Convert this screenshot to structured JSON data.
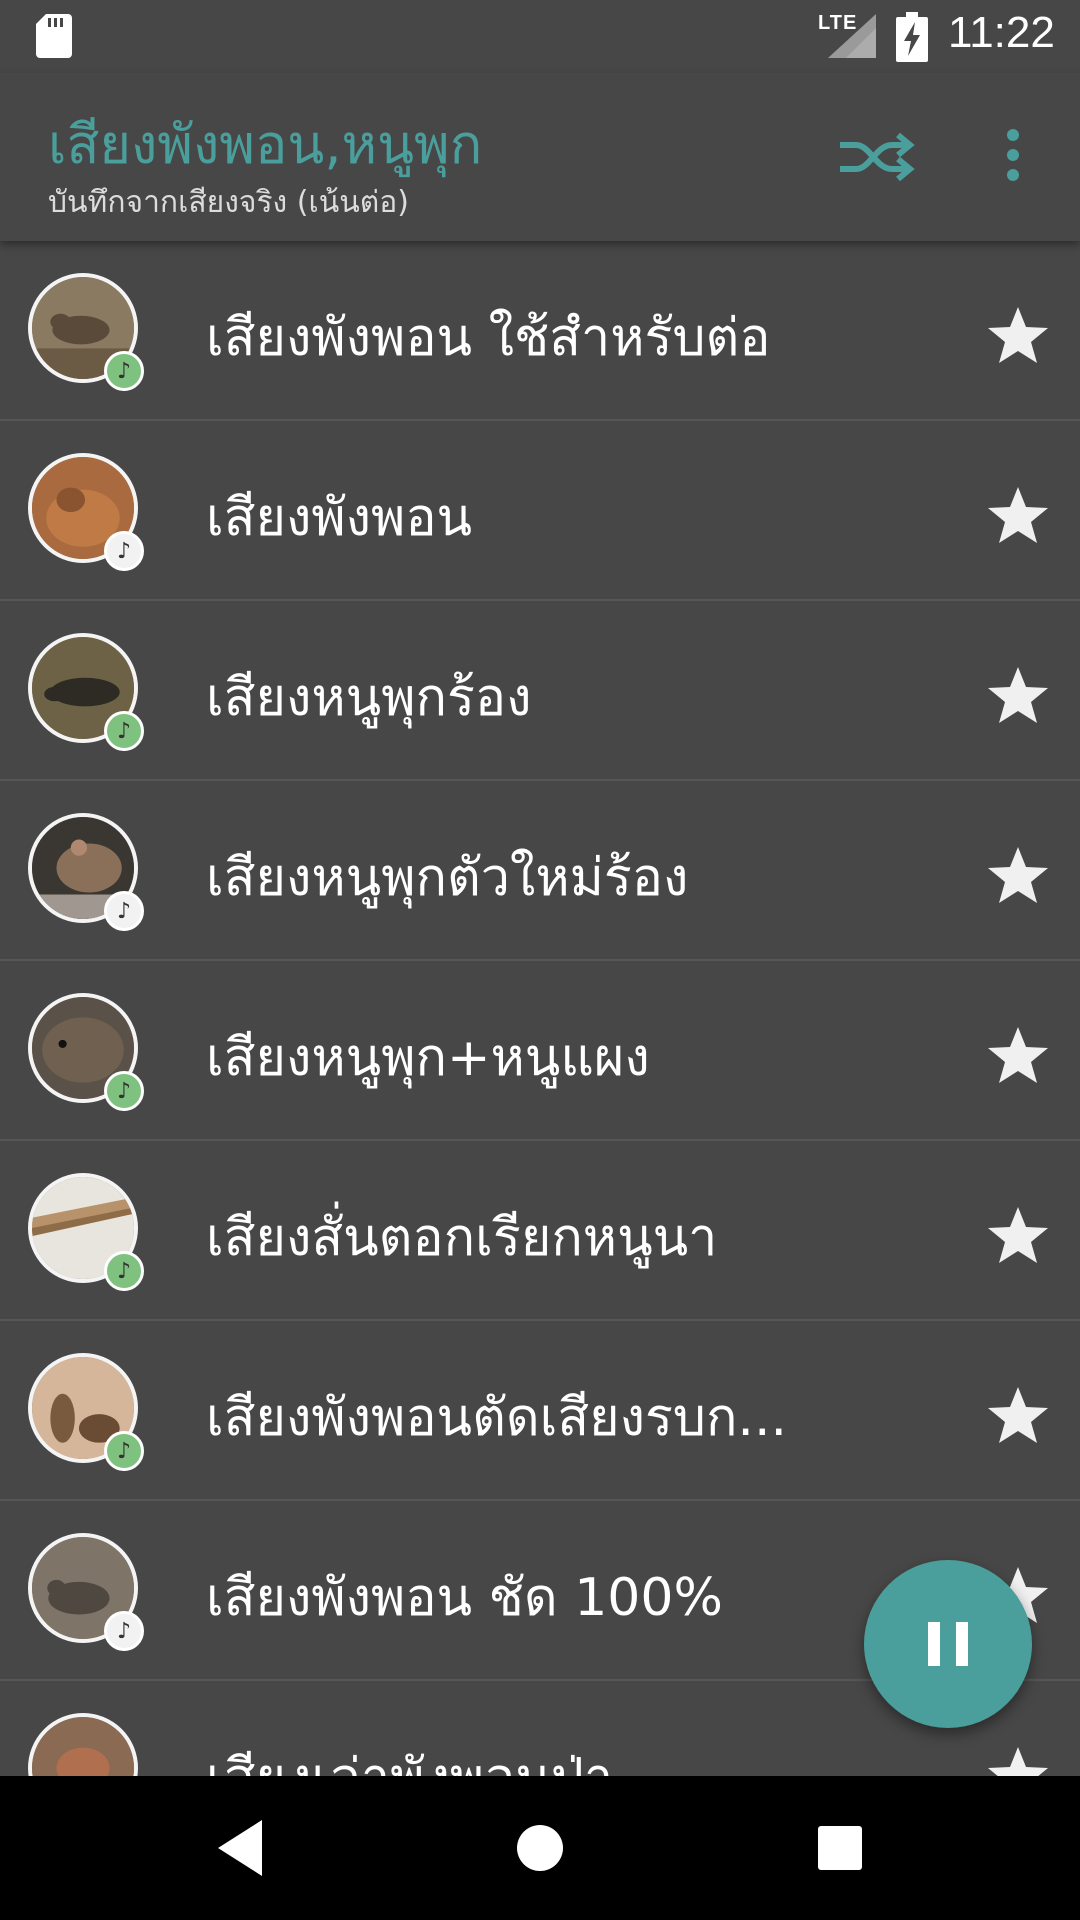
{
  "status_bar": {
    "time": "11:22",
    "network": "LTE",
    "icons": [
      "sd-card-icon",
      "signal-icon",
      "battery-charging-icon"
    ]
  },
  "app_bar": {
    "title": "เสียงพังพอน,หนูพุก",
    "subtitle": "บันทึกจากเสียงจริง (เน้นต่อ)",
    "actions": [
      "shuffle-icon",
      "more-vert-icon"
    ]
  },
  "list": {
    "items": [
      {
        "title": "เสียงพังพอน ใช้สำหรับต่อ",
        "badge": "green",
        "image": "mongoose"
      },
      {
        "title": "เสียงพังพอน",
        "badge": "white",
        "image": "mongoose-orange"
      },
      {
        "title": "เสียงหนูพุกร้อง",
        "badge": "green",
        "image": "rat-dark"
      },
      {
        "title": "เสียงหนูพุกตัวใหม่ร้อง",
        "badge": "white",
        "image": "rat-brown"
      },
      {
        "title": "เสียงหนูพุก+หนูแผง",
        "badge": "green",
        "image": "rat-grey"
      },
      {
        "title": "เสียงสั่นตอกเรียกหนูนา",
        "badge": "green",
        "image": "reeds"
      },
      {
        "title": "เสียงพังพอนตัดเสียงรบก...",
        "badge": "green",
        "image": "mongoose-pair"
      },
      {
        "title": "เสียงพังพอน ชัด 100%",
        "badge": "white",
        "image": "mongoose-grey"
      },
      {
        "title": "เสียงเล่าพังพอนป่า",
        "badge": "green",
        "image": "mongoose-red"
      }
    ]
  },
  "fab": {
    "icon": "pause-icon",
    "color": "#4a9e9b"
  },
  "nav_bar": {
    "icons": [
      "back-icon",
      "home-icon",
      "recents-icon"
    ]
  },
  "colors": {
    "accent": "#4a9e9b",
    "background": "#474747",
    "badge_green": "#7fc27f"
  }
}
